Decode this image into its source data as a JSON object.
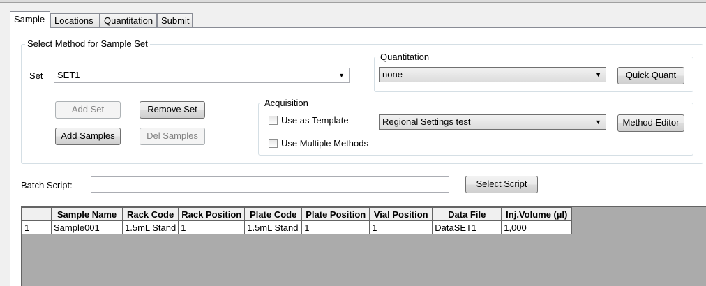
{
  "tabs": [
    "Sample",
    "Locations",
    "Quantitation",
    "Submit"
  ],
  "method_group": {
    "title": "Select Method for Sample Set",
    "set_label": "Set",
    "set_value": "SET1",
    "add_set": "Add Set",
    "remove_set": "Remove Set",
    "add_samples": "Add Samples",
    "del_samples": "Del Samples"
  },
  "quantitation": {
    "title": "Quantitation",
    "value": "none",
    "quick_quant": "Quick Quant"
  },
  "acquisition": {
    "title": "Acquisition",
    "use_as_template": "Use as Template",
    "use_multiple_methods": "Use Multiple Methods",
    "method": "Regional Settings test",
    "method_editor": "Method Editor"
  },
  "batch_script": {
    "label": "Batch Script:",
    "value": "",
    "select_script": "Select Script"
  },
  "table": {
    "columns": [
      "Sample Name",
      "Rack Code",
      "Rack Position",
      "Plate Code",
      "Plate Position",
      "Vial Position",
      "Data File",
      "Inj.Volume (µl)"
    ],
    "rows": [
      {
        "num": "1",
        "cells": [
          "Sample001",
          "1.5mL Stand",
          "1",
          "1.5mL Stand",
          "1",
          "1",
          "DataSET1",
          "1,000"
        ]
      }
    ]
  }
}
